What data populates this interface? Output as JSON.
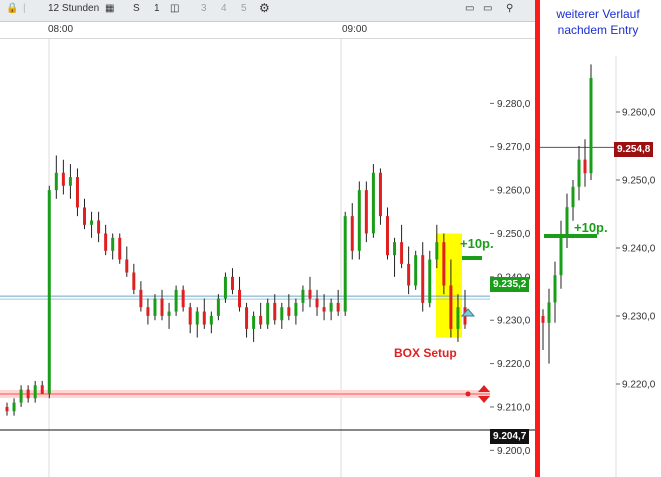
{
  "toolbar": {
    "period_label": "12 Stunden",
    "items": [
      "S",
      "1",
      "3",
      "4",
      "5"
    ]
  },
  "time_labels": [
    "08:00",
    "09:00"
  ],
  "annotations": {
    "box_setup": "BOX Setup",
    "gain_left": "+10p.",
    "gain_right": "+10p.",
    "note_line1": "weiterer Verlauf",
    "note_line2": "nachdem Entry"
  },
  "price_tags": {
    "current": "9.235,2",
    "level": "9.204,7",
    "right_current": "9.254,8"
  },
  "colors": {
    "up": "#1a9e1a",
    "down": "#e02020",
    "divider": "#ff1a1a",
    "box": "#ffff00",
    "note": "#1a2fd0",
    "tag_green": "#1a9e1a",
    "tag_dark": "#111111",
    "tag_darkred": "#9b1010"
  },
  "chart_data": [
    {
      "type": "candlestick",
      "x_axis_labels": [
        "08:00",
        "09:00"
      ],
      "y_ticks": [
        "9.200,0",
        "9.210,0",
        "9.220,0",
        "9.230,0",
        "9.240,0",
        "9.250,0",
        "9.260,0",
        "9.270,0",
        "9.280,0"
      ],
      "ylim": [
        9198,
        9290
      ],
      "candles": [
        [
          9210,
          9211,
          9208,
          9209
        ],
        [
          9209,
          9212,
          9208,
          9211
        ],
        [
          9211,
          9215,
          9210,
          9214
        ],
        [
          9214,
          9215,
          9211,
          9212
        ],
        [
          9212,
          9216,
          9211,
          9215
        ],
        [
          9215,
          9216,
          9213,
          9213
        ],
        [
          9213,
          9261,
          9212,
          9260
        ],
        [
          9260,
          9268,
          9258,
          9264
        ],
        [
          9264,
          9267,
          9259,
          9261
        ],
        [
          9261,
          9266,
          9258,
          9263
        ],
        [
          9263,
          9265,
          9254,
          9256
        ],
        [
          9256,
          9258,
          9251,
          9252
        ],
        [
          9252,
          9255,
          9249,
          9253
        ],
        [
          9253,
          9255,
          9248,
          9250
        ],
        [
          9250,
          9252,
          9245,
          9246
        ],
        [
          9246,
          9250,
          9244,
          9249
        ],
        [
          9249,
          9250,
          9243,
          9244
        ],
        [
          9244,
          9247,
          9240,
          9241
        ],
        [
          9241,
          9243,
          9236,
          9237
        ],
        [
          9237,
          9239,
          9232,
          9233
        ],
        [
          9233,
          9235,
          9229,
          9231
        ],
        [
          9231,
          9236,
          9230,
          9235
        ],
        [
          9235,
          9237,
          9230,
          9231
        ],
        [
          9231,
          9234,
          9228,
          9232
        ],
        [
          9232,
          9238,
          9231,
          9237
        ],
        [
          9237,
          9238,
          9232,
          9233
        ],
        [
          9233,
          9234,
          9227,
          9229
        ],
        [
          9229,
          9233,
          9226,
          9232
        ],
        [
          9232,
          9235,
          9228,
          9229
        ],
        [
          9229,
          9232,
          9227,
          9231
        ],
        [
          9231,
          9236,
          9230,
          9235
        ],
        [
          9235,
          9241,
          9234,
          9240
        ],
        [
          9240,
          9242,
          9236,
          9237
        ],
        [
          9237,
          9240,
          9232,
          9233
        ],
        [
          9233,
          9234,
          9226,
          9228
        ],
        [
          9228,
          9232,
          9225,
          9231
        ],
        [
          9231,
          9234,
          9228,
          9229
        ],
        [
          9229,
          9235,
          9228,
          9234
        ],
        [
          9234,
          9236,
          9229,
          9230
        ],
        [
          9230,
          9234,
          9228,
          9233
        ],
        [
          9233,
          9236,
          9230,
          9231
        ],
        [
          9231,
          9235,
          9229,
          9234
        ],
        [
          9234,
          9238,
          9232,
          9237
        ],
        [
          9237,
          9240,
          9233,
          9235
        ],
        [
          9235,
          9237,
          9231,
          9233
        ],
        [
          9233,
          9236,
          9230,
          9232
        ],
        [
          9232,
          9235,
          9230,
          9234
        ],
        [
          9234,
          9237,
          9231,
          9232
        ],
        [
          9232,
          9255,
          9231,
          9254
        ],
        [
          9254,
          9257,
          9244,
          9246
        ],
        [
          9246,
          9262,
          9244,
          9260
        ],
        [
          9260,
          9262,
          9248,
          9250
        ],
        [
          9250,
          9266,
          9249,
          9264
        ],
        [
          9264,
          9265,
          9252,
          9254
        ],
        [
          9254,
          9256,
          9244,
          9245
        ],
        [
          9245,
          9249,
          9240,
          9248
        ],
        [
          9248,
          9252,
          9242,
          9243
        ],
        [
          9243,
          9247,
          9236,
          9238
        ],
        [
          9238,
          9246,
          9237,
          9245
        ],
        [
          9245,
          9248,
          9232,
          9234
        ],
        [
          9234,
          9246,
          9233,
          9244
        ],
        [
          9244,
          9252,
          9242,
          9248
        ],
        [
          9248,
          9250,
          9236,
          9238
        ],
        [
          9238,
          9244,
          9226,
          9228
        ],
        [
          9228,
          9236,
          9225,
          9233
        ],
        [
          9233,
          9237,
          9228,
          9229
        ]
      ],
      "horizontal_lines": [
        {
          "value": 9235.2,
          "label": "9.235,2"
        },
        {
          "value": 9213.0
        },
        {
          "value": 9204.7,
          "label": "9.204,7"
        }
      ]
    },
    {
      "type": "candlestick",
      "y_ticks": [
        "9.220,0",
        "9.230,0",
        "9.240,0",
        "9.250,0",
        "9.260,0"
      ],
      "ylim": [
        9212,
        9272
      ],
      "candles": [
        [
          9230,
          9231,
          9225,
          9229
        ],
        [
          9229,
          9234,
          9223,
          9232
        ],
        [
          9232,
          9238,
          9229,
          9236
        ],
        [
          9236,
          9244,
          9234,
          9242
        ],
        [
          9242,
          9248,
          9240,
          9246
        ],
        [
          9246,
          9250,
          9244,
          9249
        ],
        [
          9249,
          9255,
          9247,
          9253
        ],
        [
          9253,
          9256,
          9249,
          9251
        ],
        [
          9251,
          9267,
          9250,
          9265
        ]
      ],
      "horizontal_lines": [
        {
          "value": 9254.8,
          "label": "9.254,8"
        }
      ]
    }
  ]
}
